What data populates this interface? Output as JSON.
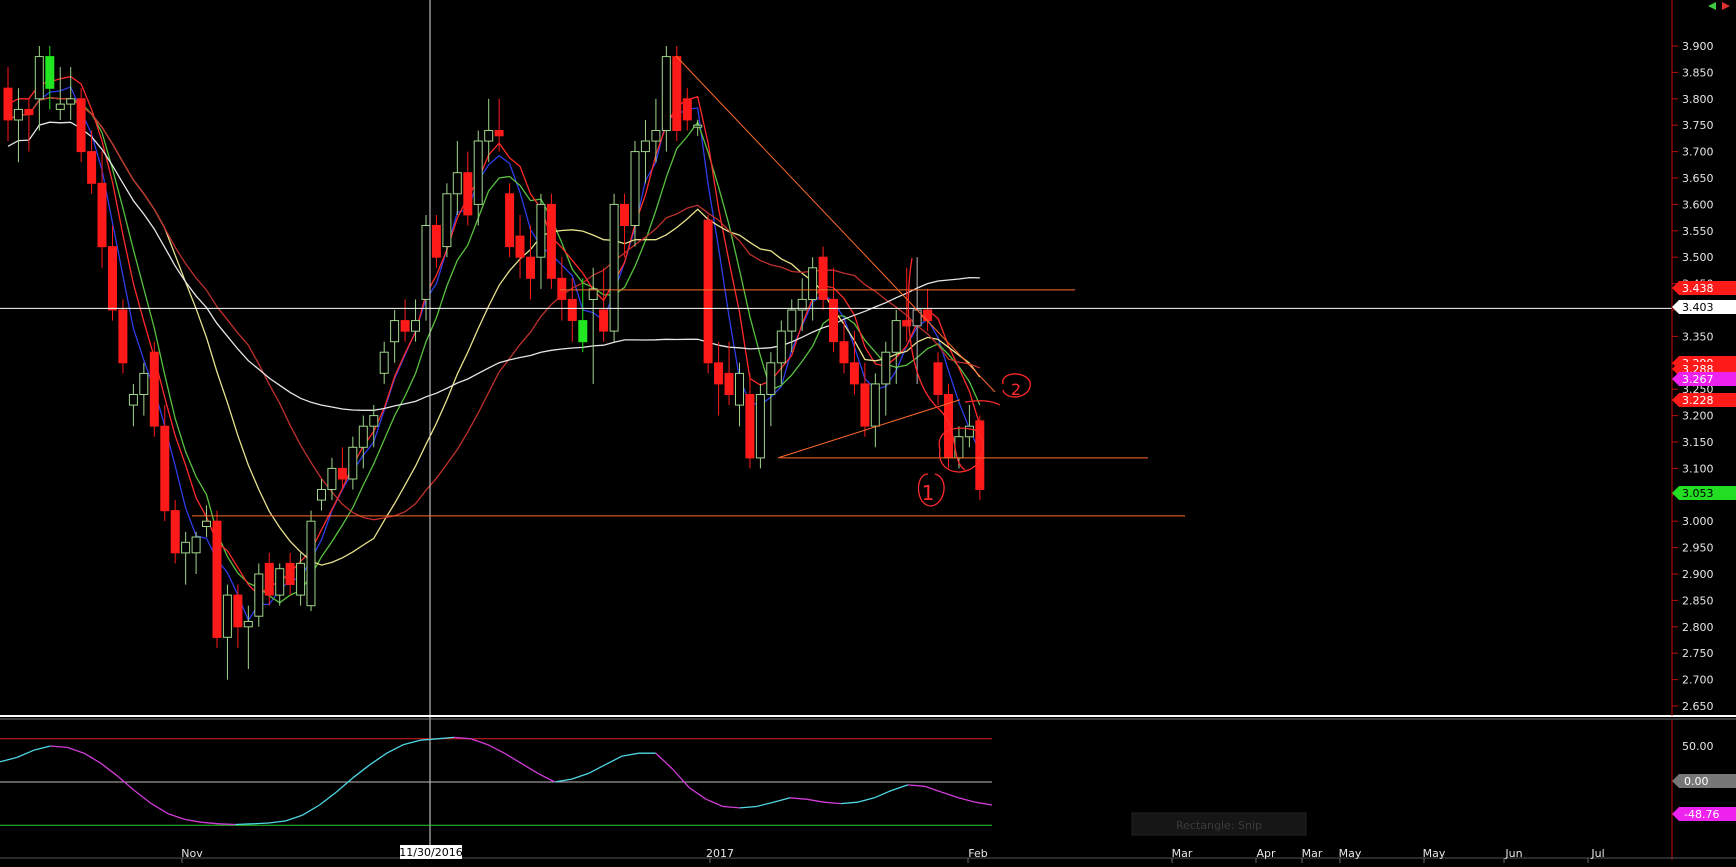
{
  "colors": {
    "background": "#000000",
    "up_candle": "#9fd68a",
    "down_candle": "#ff1a1a",
    "ma_blue": "#2e3de8",
    "ma_green": "#58c13f",
    "ma_yellow": "#e8e28c",
    "ma_red_fast": "#ff2a2a",
    "ma_red_slow": "#c0302c",
    "ma_white": "#e6e6e6",
    "trendline": "#ff6a2a",
    "osc_cyan": "#4fd8e6",
    "osc_magenta": "#d23cd8",
    "price_tag_red": "#ff1a1a",
    "price_tag_green": "#22dd22",
    "price_tag_magenta": "#ee22ee",
    "price_tag_white": "#ffffff"
  },
  "chart_data": [
    {
      "type": "candlestick",
      "title": "",
      "xlabel": "",
      "ylabel": "",
      "ylim": [
        2.62,
        3.92
      ],
      "y_ticks": [
        "3.900",
        "3.850",
        "3.800",
        "3.750",
        "3.700",
        "3.650",
        "3.600",
        "3.550",
        "3.500",
        "3.450",
        "3.400",
        "3.350",
        "3.300",
        "3.250",
        "3.200",
        "3.150",
        "3.100",
        "3.050",
        "3.000",
        "2.950",
        "2.900",
        "2.850",
        "2.800",
        "2.750",
        "2.700",
        "2.650"
      ],
      "x_ticks": [
        "Nov",
        "11/30/2016",
        "2017",
        "Feb",
        "Mar",
        "Apr",
        "Mar",
        "May",
        "May",
        "Jun",
        "Jul"
      ],
      "candles": [
        [
          3.82,
          3.86,
          3.72,
          3.76
        ],
        [
          3.76,
          3.82,
          3.68,
          3.78
        ],
        [
          3.78,
          3.8,
          3.7,
          3.77
        ],
        [
          3.8,
          3.9,
          3.74,
          3.88
        ],
        [
          3.88,
          3.9,
          3.78,
          3.82
        ],
        [
          3.78,
          3.86,
          3.76,
          3.79
        ],
        [
          3.79,
          3.86,
          3.76,
          3.8
        ],
        [
          3.8,
          3.82,
          3.68,
          3.7
        ],
        [
          3.7,
          3.74,
          3.62,
          3.64
        ],
        [
          3.64,
          3.7,
          3.48,
          3.52
        ],
        [
          3.52,
          3.56,
          3.38,
          3.4
        ],
        [
          3.4,
          3.42,
          3.28,
          3.3
        ],
        [
          3.22,
          3.26,
          3.18,
          3.24
        ],
        [
          3.24,
          3.3,
          3.2,
          3.28
        ],
        [
          3.32,
          3.34,
          3.16,
          3.18
        ],
        [
          3.18,
          3.22,
          3.0,
          3.02
        ],
        [
          3.02,
          3.04,
          2.92,
          2.94
        ],
        [
          2.94,
          2.98,
          2.88,
          2.96
        ],
        [
          2.94,
          2.98,
          2.9,
          2.97
        ],
        [
          2.99,
          3.03,
          2.97,
          3.0
        ],
        [
          3.0,
          3.02,
          2.76,
          2.78
        ],
        [
          2.78,
          2.88,
          2.7,
          2.86
        ],
        [
          2.86,
          2.88,
          2.76,
          2.8
        ],
        [
          2.8,
          2.84,
          2.72,
          2.81
        ],
        [
          2.82,
          2.92,
          2.8,
          2.9
        ],
        [
          2.92,
          2.94,
          2.84,
          2.86
        ],
        [
          2.86,
          2.92,
          2.84,
          2.91
        ],
        [
          2.92,
          2.94,
          2.86,
          2.88
        ],
        [
          2.86,
          2.94,
          2.84,
          2.92
        ],
        [
          2.84,
          3.02,
          2.83,
          3.0
        ],
        [
          3.04,
          3.08,
          3.02,
          3.06
        ],
        [
          3.06,
          3.12,
          3.04,
          3.1
        ],
        [
          3.1,
          3.14,
          3.06,
          3.08
        ],
        [
          3.08,
          3.16,
          3.06,
          3.14
        ],
        [
          3.14,
          3.2,
          3.1,
          3.18
        ],
        [
          3.18,
          3.22,
          3.14,
          3.2
        ],
        [
          3.28,
          3.34,
          3.26,
          3.32
        ],
        [
          3.34,
          3.4,
          3.3,
          3.38
        ],
        [
          3.38,
          3.42,
          3.34,
          3.36
        ],
        [
          3.36,
          3.42,
          3.34,
          3.38
        ],
        [
          3.42,
          3.58,
          3.38,
          3.56
        ],
        [
          3.56,
          3.58,
          3.48,
          3.5
        ],
        [
          3.52,
          3.64,
          3.5,
          3.62
        ],
        [
          3.62,
          3.72,
          3.58,
          3.66
        ],
        [
          3.66,
          3.7,
          3.56,
          3.58
        ],
        [
          3.6,
          3.74,
          3.56,
          3.72
        ],
        [
          3.72,
          3.8,
          3.68,
          3.74
        ],
        [
          3.74,
          3.8,
          3.7,
          3.73
        ],
        [
          3.62,
          3.64,
          3.5,
          3.52
        ],
        [
          3.54,
          3.58,
          3.46,
          3.5
        ],
        [
          3.5,
          3.56,
          3.42,
          3.46
        ],
        [
          3.5,
          3.62,
          3.44,
          3.6
        ],
        [
          3.6,
          3.62,
          3.44,
          3.46
        ],
        [
          3.46,
          3.5,
          3.38,
          3.42
        ],
        [
          3.42,
          3.46,
          3.34,
          3.38
        ],
        [
          3.38,
          3.46,
          3.32,
          3.34
        ],
        [
          3.42,
          3.48,
          3.26,
          3.44
        ],
        [
          3.4,
          3.48,
          3.34,
          3.36
        ],
        [
          3.36,
          3.62,
          3.34,
          3.6
        ],
        [
          3.6,
          3.62,
          3.5,
          3.56
        ],
        [
          3.56,
          3.72,
          3.52,
          3.7
        ],
        [
          3.7,
          3.76,
          3.64,
          3.72
        ],
        [
          3.72,
          3.8,
          3.68,
          3.74
        ],
        [
          3.74,
          3.9,
          3.7,
          3.88
        ],
        [
          3.88,
          3.9,
          3.72,
          3.74
        ],
        [
          3.8,
          3.82,
          3.74,
          3.76
        ],
        [
          3.75,
          3.76,
          3.73,
          3.75
        ],
        [
          3.57,
          3.58,
          3.28,
          3.3
        ],
        [
          3.3,
          3.34,
          3.2,
          3.26
        ],
        [
          3.28,
          3.34,
          3.22,
          3.24
        ],
        [
          3.22,
          3.3,
          3.18,
          3.28
        ],
        [
          3.24,
          3.28,
          3.1,
          3.12
        ],
        [
          3.12,
          3.26,
          3.1,
          3.24
        ],
        [
          3.24,
          3.32,
          3.18,
          3.3
        ],
        [
          3.3,
          3.38,
          3.26,
          3.36
        ],
        [
          3.36,
          3.42,
          3.32,
          3.4
        ],
        [
          3.4,
          3.46,
          3.36,
          3.42
        ],
        [
          3.42,
          3.5,
          3.38,
          3.48
        ],
        [
          3.5,
          3.52,
          3.4,
          3.42
        ],
        [
          3.42,
          3.48,
          3.32,
          3.34
        ],
        [
          3.34,
          3.38,
          3.28,
          3.3
        ],
        [
          3.3,
          3.36,
          3.24,
          3.26
        ],
        [
          3.26,
          3.3,
          3.16,
          3.18
        ],
        [
          3.18,
          3.28,
          3.14,
          3.26
        ],
        [
          3.26,
          3.34,
          3.2,
          3.32
        ],
        [
          3.32,
          3.4,
          3.26,
          3.38
        ],
        [
          3.38,
          3.48,
          3.34,
          3.37
        ],
        [
          3.37,
          3.5,
          3.26,
          3.4
        ],
        [
          3.4,
          3.44,
          3.36,
          3.38
        ],
        [
          3.3,
          3.32,
          3.22,
          3.24
        ],
        [
          3.24,
          3.26,
          3.1,
          3.12
        ],
        [
          3.12,
          3.18,
          3.1,
          3.16
        ],
        [
          3.16,
          3.22,
          3.14,
          3.18
        ],
        [
          3.19,
          3.2,
          3.04,
          3.06
        ]
      ],
      "up_color_override": [
        [
          4,
          "green"
        ],
        [
          55,
          "green"
        ]
      ],
      "gray_marker_index": 87,
      "horizontal_lines": [
        3.438,
        3.403,
        3.12,
        3.01
      ],
      "price_tags": [
        "3.438",
        "3.403",
        "3.299",
        "3.288",
        "3.267",
        "3.228",
        "3.053"
      ],
      "annotations": [
        "1",
        "2"
      ],
      "tooltip": "Rectangle: Snip"
    },
    {
      "type": "line",
      "title": "",
      "ylim": [
        -55,
        65
      ],
      "y_ticks": [
        "50.00",
        "0.00"
      ],
      "price_tags": [
        "0.00",
        "-48.76"
      ],
      "levels": [
        60,
        0,
        -60
      ],
      "series": [
        {
          "values": [
            28,
            34,
            44,
            50,
            48,
            40,
            26,
            8,
            -12,
            -30,
            -44,
            -52,
            -56,
            -58,
            -59,
            -58,
            -57,
            -54,
            -46,
            -32,
            -14,
            6,
            24,
            40,
            52,
            58,
            60,
            62,
            60,
            52,
            40,
            26,
            12,
            0,
            4,
            12,
            24,
            36,
            40,
            40,
            18,
            -8,
            -24,
            -34,
            -36,
            -34,
            -28,
            -22,
            -24,
            -28,
            -30,
            -28,
            -22,
            -12,
            -4,
            -6,
            -14,
            -22,
            -28,
            -32
          ]
        }
      ]
    }
  ]
}
